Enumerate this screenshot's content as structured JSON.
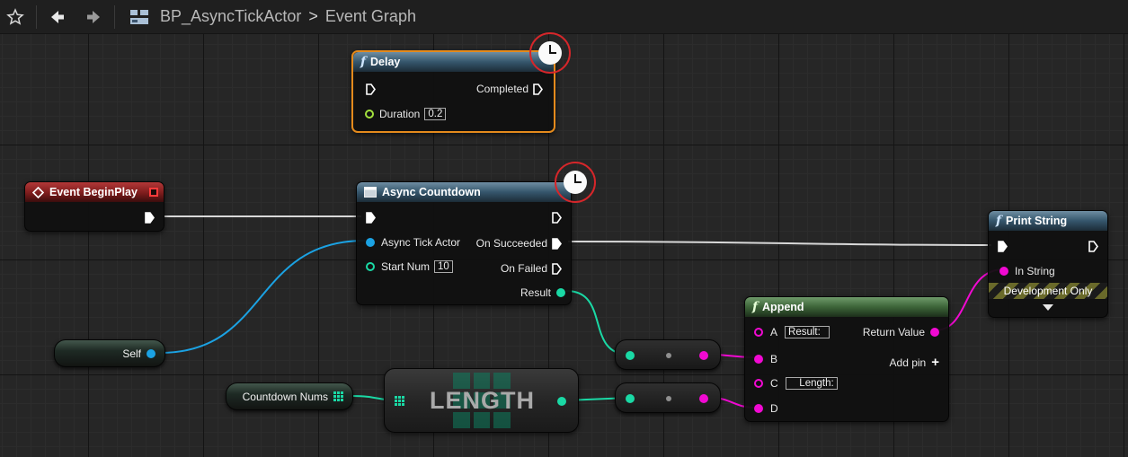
{
  "toolbar": {
    "favorite_icon": "star-outline-icon",
    "back_icon": "arrow-left-icon",
    "forward_icon": "arrow-right-icon",
    "graph_icon": "blueprint-graph-icon",
    "breadcrumb_asset": "BP_AsyncTickActor",
    "breadcrumb_separator": ">",
    "breadcrumb_graph": "Event Graph"
  },
  "colors": {
    "exec_pin": "#ffffff",
    "object_pin": "#1ba2e3",
    "int_pin": "#1ad9a5",
    "string_pin": "#f109d2",
    "float_pin": "#a4e23e",
    "selection": "#e48a1c",
    "latent_clock_ring": "#d6262a"
  },
  "nodes": {
    "delay": {
      "title": "Delay",
      "completed_label": "Completed",
      "duration_label": "Duration",
      "duration_value": "0.2"
    },
    "event_begin_play": {
      "title": "Event BeginPlay"
    },
    "async_countdown": {
      "title": "Async Countdown",
      "async_tick_actor_label": "Async Tick Actor",
      "start_num_label": "Start Num",
      "start_num_value": "10",
      "on_succeeded_label": "On Succeeded",
      "on_failed_label": "On Failed",
      "result_label": "Result"
    },
    "print_string": {
      "title": "Print String",
      "in_string_label": "In String",
      "development_only": "Development Only"
    },
    "append": {
      "title": "Append",
      "a_label": "A",
      "a_value": "Result:",
      "b_label": "B",
      "c_label": "C",
      "c_value": "Length:",
      "d_label": "D",
      "return_value_label": "Return Value",
      "add_pin_label": "Add pin"
    },
    "self_var": {
      "label": "Self"
    },
    "countdown_nums_var": {
      "label": "Countdown Nums"
    },
    "length": {
      "label": "LENGTH"
    }
  }
}
